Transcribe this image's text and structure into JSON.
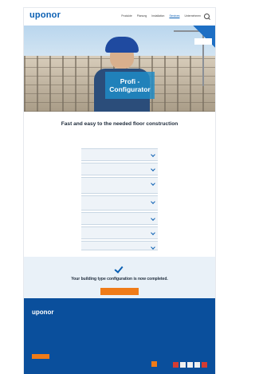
{
  "header": {
    "logo": "uponor",
    "nav": [
      "Produkte",
      "Planung",
      "Installation",
      "Services",
      "Unternehmen"
    ]
  },
  "hero": {
    "title_line1": "Profi -",
    "title_line2": "Configurator"
  },
  "main": {
    "title": "Fast and easy to the needed floor construction",
    "subtitle": "",
    "list_title": "",
    "items": [
      {
        "label": "",
        "sub": ""
      },
      {
        "label": "",
        "sub": ""
      },
      {
        "label": "",
        "sub": ""
      },
      {
        "label": "",
        "sub": ""
      },
      {
        "label": "",
        "sub": ""
      },
      {
        "label": "",
        "sub": ""
      },
      {
        "label": "",
        "sub": ""
      }
    ],
    "back_link": ""
  },
  "completion": {
    "text": "Your building type configuration is now completed.",
    "button": ""
  },
  "footer": {
    "logo": "uponor"
  },
  "colors": {
    "brand_blue": "#0a5fb3",
    "accent_orange": "#ef7b18",
    "footer_blue": "#0a4f9c"
  }
}
